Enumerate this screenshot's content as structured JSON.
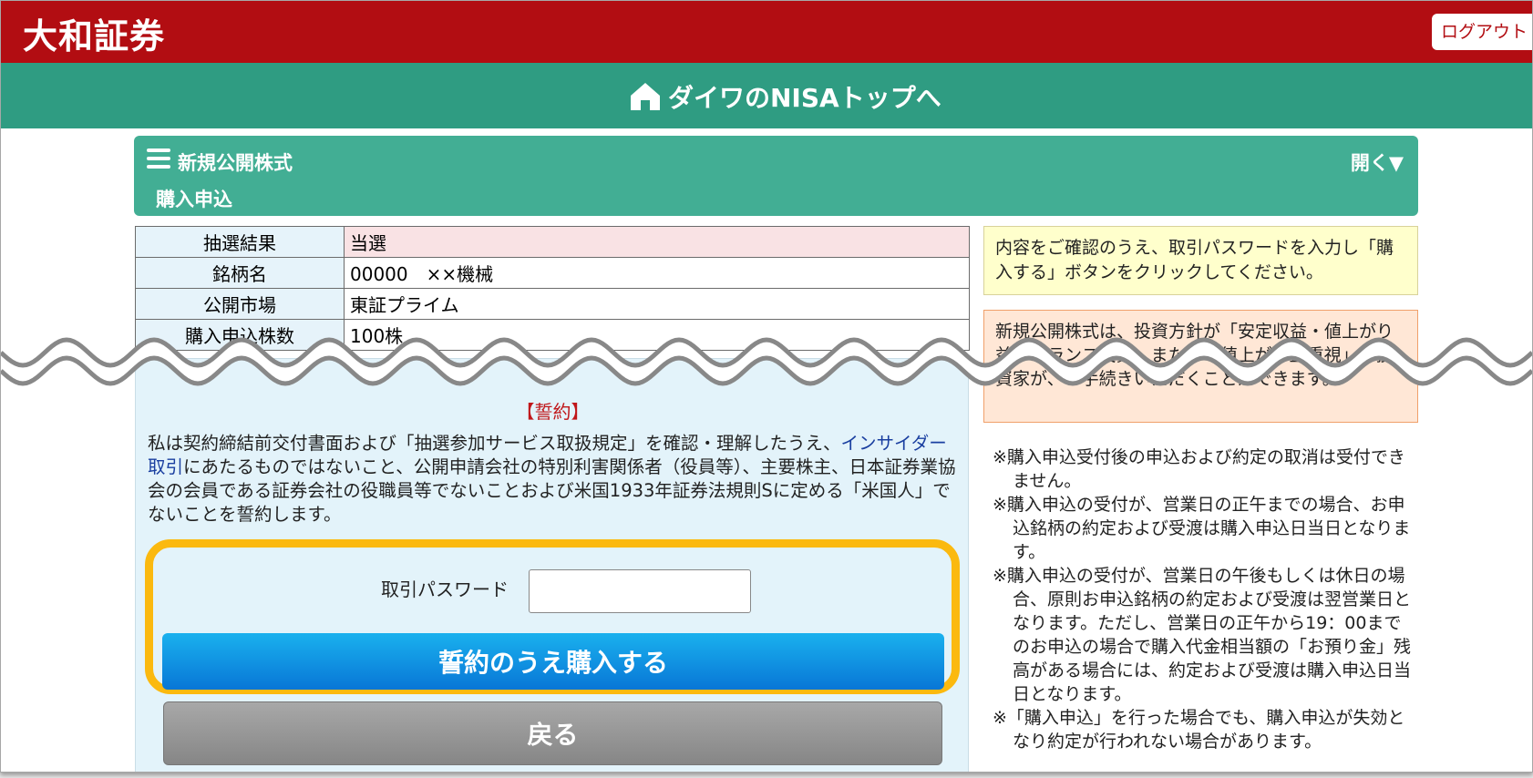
{
  "header": {
    "logo_text": "大和証券",
    "logout_label": "ログアウト",
    "brand_color": "#b20d12"
  },
  "nisa_bar": {
    "label": "ダイワのNISAトップへ",
    "icon": "house-icon",
    "color": "#2f9c82"
  },
  "section": {
    "title": "新規公開株式",
    "subtitle": "購入申込",
    "toggle_label": "開く▼",
    "icon": "menu-icon"
  },
  "info_table": {
    "rows": [
      {
        "label": "抽選結果",
        "value": "当選"
      },
      {
        "label": "銘柄名",
        "value": "00000　××機械"
      },
      {
        "label": "公開市場",
        "value": "東証プライム"
      },
      {
        "label": "購入申込株数",
        "value": "100株"
      }
    ]
  },
  "oath": {
    "title": "【誓約】",
    "text_before_link": "私は契約締結前交付書面および「抽選参加サービス取扱規定」を確認・理解したうえ、",
    "link_text": "インサイダー取引",
    "text_after_link": "にあたるものではないこと、公開申請会社の特別利害関係者（役員等）、主要株主、日本証券業協会の会員である証券会社の役職員等でないことおよび米国1933年証券法規則Sに定める「米国人」でないことを誓約します。",
    "password_label": "取引パスワード",
    "password_value": "",
    "buy_button_label": "誓約のうえ購入する",
    "back_button_label": "戻る"
  },
  "right": {
    "notice_yellow": "内容をご確認のうえ、取引パスワードを入力し「購入する」ボタンをクリックしてください。",
    "notice_orange": "新規公開株式は、投資方針が「安定収益・値上がり益のバランス投資」または「値上がり益重視」の投資家が、お手続きいただくことができます。",
    "notes": [
      "※購入申込受付後の申込および約定の取消は受付できません。",
      "※購入申込の受付が、営業日の正午までの場合、お申込銘柄の約定および受渡は購入申込日当日となります。",
      "※購入申込の受付が、営業日の午後もしくは休日の場合、原則お申込銘柄の約定および受渡は翌営業日となります。ただし、営業日の正午から19：00までのお申込の場合で購入代金相当額の「お預り金」残高がある場合には、約定および受渡は購入申込日当日となります。",
      "※「購入申込」を行った場合でも、購入申込が失効となり約定が行われない場合があります。"
    ]
  },
  "highlight_color": "#fbb90f"
}
